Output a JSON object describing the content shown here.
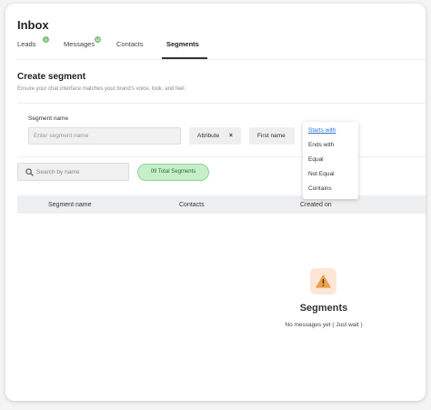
{
  "app": {
    "title": "Inbox"
  },
  "tabs": [
    {
      "label": "Leads",
      "badge": "4",
      "active": false
    },
    {
      "label": "Messages",
      "badge": "12",
      "active": false
    },
    {
      "label": "Contacts",
      "active": false
    },
    {
      "label": "Segments",
      "active": true
    }
  ],
  "section": {
    "title": "Create segment",
    "subtitle": "Ensure your chat interface matches your brand's voice, look, and feel."
  },
  "segment_form": {
    "name_label": "Segment name",
    "name_placeholder": "Enter segment name",
    "attribute_chip": "Attribute",
    "close_glyph": "×",
    "field_chip": "First name"
  },
  "condition_dropdown": {
    "selected": "Starts with",
    "options": [
      "Starts with",
      "Ends with",
      "Equal",
      "Not Equal",
      "Contains"
    ]
  },
  "search": {
    "placeholder": "Search by name"
  },
  "total_badge": "09 Total Segments",
  "table": {
    "columns": [
      "Segment name",
      "Contacts",
      "Created on"
    ]
  },
  "empty_state": {
    "icon": "warning-icon",
    "title": "Segments",
    "message": "No messages yet ( Just wait )"
  },
  "colors": {
    "accent_link": "#2a6fd6",
    "badge_green": "#c6eec8",
    "warning_orange": "#f0a04b"
  }
}
